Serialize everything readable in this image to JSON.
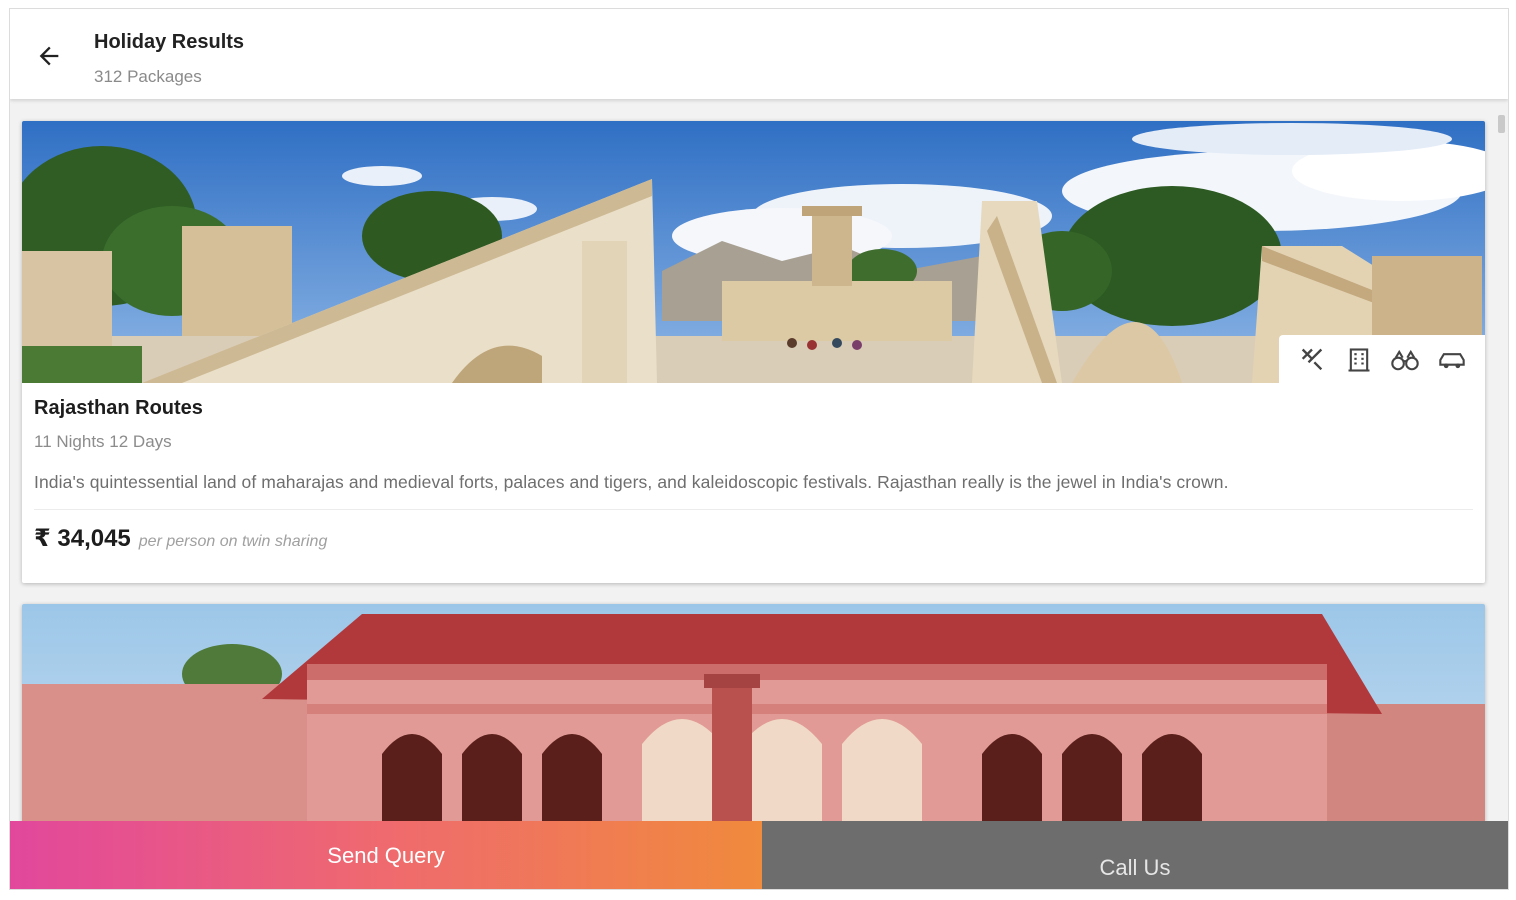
{
  "header": {
    "title": "Holiday Results",
    "subtitle": "312 Packages",
    "back_icon": "arrow-left-icon"
  },
  "packages": [
    {
      "title": "Rajasthan Routes",
      "duration": "11 Nights 12 Days",
      "description": "India's quintessential land of maharajas and medieval forts, palaces and tigers, and kaleidoscopic festivals. Rajasthan really is the jewel in India's crown.",
      "price": "₹ 34,045",
      "price_note": "per person on twin sharing",
      "image": "jantar-mantar-observatory",
      "amenities": [
        "meals-icon",
        "hotel-icon",
        "sightseeing-icon",
        "transfer-car-icon"
      ]
    },
    {
      "image": "city-palace-pink-pavilion"
    }
  ],
  "actions": {
    "send_query": "Send Query",
    "call_us": "Call Us"
  },
  "colors": {
    "query_gradient_start": "#e2479c",
    "query_gradient_end": "#f08a3c",
    "call_bg": "#6d6d6d"
  }
}
